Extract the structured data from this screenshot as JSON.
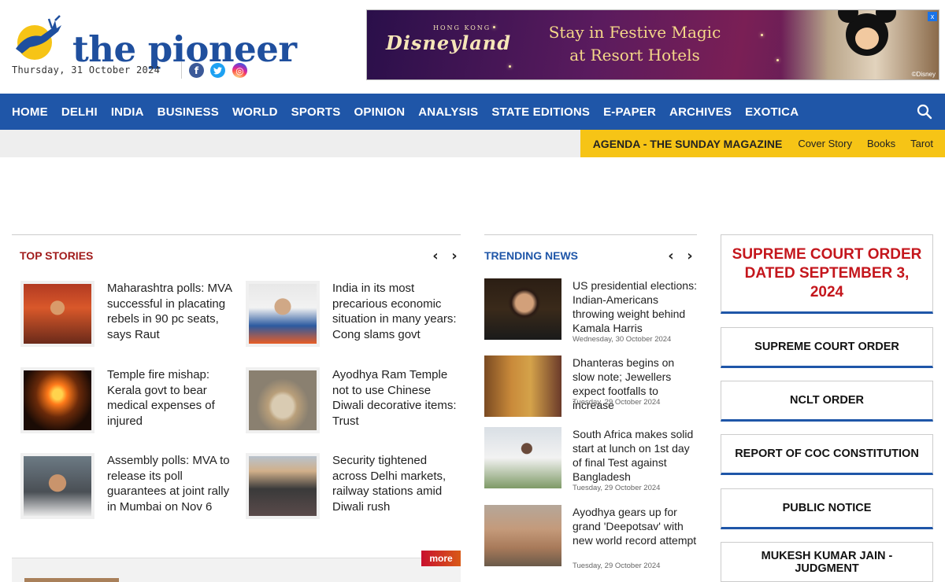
{
  "header": {
    "logo_text": "the pioneer",
    "date": "Thursday, 31 October 2024",
    "social": {
      "facebook": "f",
      "twitter": "t",
      "instagram": "◎"
    }
  },
  "ad": {
    "brand_small": "HONG KONG",
    "brand": "Disneyland",
    "line1": "Stay in Festive Magic",
    "line2": "at Resort Hotels",
    "copyright": "©Disney",
    "close": "x"
  },
  "nav": {
    "items": [
      "HOME",
      "DELHI",
      "INDIA",
      "BUSINESS",
      "WORLD",
      "SPORTS",
      "OPINION",
      "ANALYSIS",
      "STATE EDITIONS",
      "E-PAPER",
      "ARCHIVES",
      "EXOTICA"
    ]
  },
  "agenda": {
    "title": "AGENDA - THE SUNDAY MAGAZINE",
    "links": [
      "Cover Story",
      "Books",
      "Tarot"
    ]
  },
  "top_stories": {
    "title": "TOP STORIES",
    "more": "more",
    "items": [
      {
        "headline": "Maharashtra polls: MVA successful in placating rebels in 90 pc seats, says Raut"
      },
      {
        "headline": "India in its most precarious economic situation in many years: Cong slams govt"
      },
      {
        "headline": "Temple fire mishap: Kerala govt to bear medical expenses of injured"
      },
      {
        "headline": "Ayodhya Ram Temple not to use Chinese Diwali decorative items: Trust"
      },
      {
        "headline": "Assembly polls: MVA to release its poll guarantees at joint rally in Mumbai on Nov 6"
      },
      {
        "headline": "Security tightened across Delhi markets, railway stations amid Diwali rush"
      }
    ]
  },
  "trending": {
    "title": "TRENDING NEWS",
    "items": [
      {
        "headline": "US presidential elections: Indian-Americans throwing weight behind Kamala Harris",
        "date": "Wednesday, 30 October 2024"
      },
      {
        "headline": "Dhanteras begins on slow note; Jewellers expect footfalls to increase",
        "date": "Tuesday, 29 October 2024"
      },
      {
        "headline": "South Africa makes solid start at lunch on 1st day of final Test against Bangladesh",
        "date": "Tuesday, 29 October 2024"
      },
      {
        "headline": "Ayodhya gears up for grand 'Deepotsav' with new world record attempt",
        "date": "Tuesday, 29 October 2024"
      }
    ]
  },
  "notices": {
    "featured": "SUPREME COURT ORDER DATED SEPTEMBER 3, 2024",
    "items": [
      "SUPREME COURT ORDER",
      "NCLT ORDER",
      "REPORT OF COC CONSTITUTION",
      "PUBLIC NOTICE",
      "MUKESH KUMAR JAIN - JUDGMENT"
    ]
  },
  "colors": {
    "nav_blue": "#1f56a8",
    "agenda_yellow": "#f6c416",
    "top_stories_red": "#a11c1c",
    "notice_red": "#c4161c"
  }
}
